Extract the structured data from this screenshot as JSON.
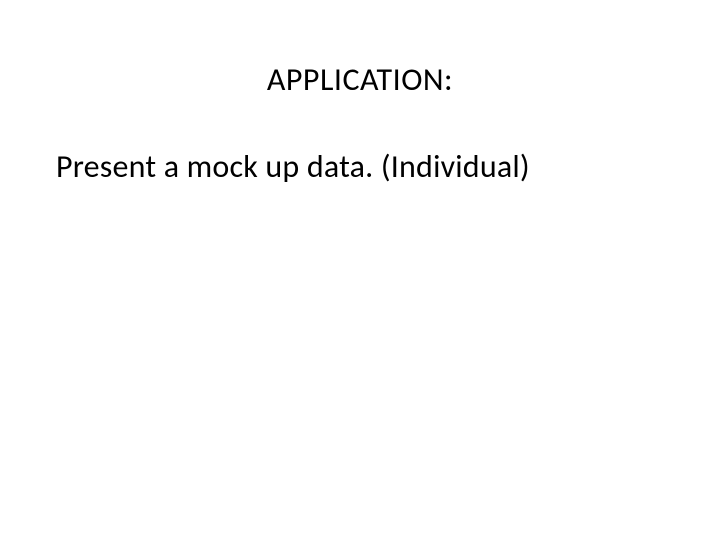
{
  "slide": {
    "title": "APPLICATION:",
    "body": "Present a mock up data. (Individual)"
  }
}
